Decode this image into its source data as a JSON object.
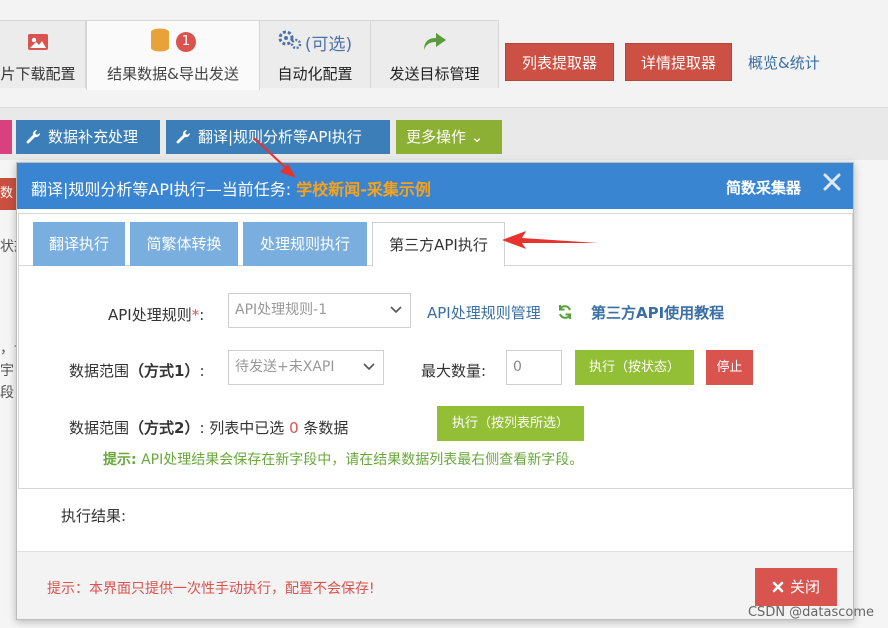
{
  "background": {
    "tabs": [
      {
        "label": "片下载配置"
      },
      {
        "label": "结果数据&导出发送",
        "badge": "1"
      },
      {
        "label": "自动化配置",
        "extra": "(可选)"
      },
      {
        "label": "发送目标管理"
      }
    ],
    "list_extractor_label": "列表提取器",
    "detail_extractor_label": "详情提取器",
    "overview_label": "概览&统计",
    "toolbar": {
      "data_fill_label": "数据补充处理",
      "api_exec_label": "翻译|规则分析等API执行",
      "more_label": "更多操作 ⌄"
    },
    "ghost_texts": [
      "数据",
      "状态",
      "，讠",
      "宇",
      "段"
    ]
  },
  "modal": {
    "title_prefix": "翻译|规则分析等API执行—当前任务: ",
    "task_name": "学校新闻-采集示例",
    "brand": "简数采集器",
    "close_icon": "close-icon",
    "tabs": [
      "翻译执行",
      "简繁体转换",
      "处理规则执行",
      "第三方API执行"
    ],
    "active_tab": "第三方API执行",
    "form": {
      "rule_label": "API处理规则",
      "required_mark": "*",
      "rule_colon": ":",
      "rule_selected": "API处理规则-1",
      "rule_manage_link": "API处理规则管理",
      "tutorial_link": "第三方API使用教程",
      "range1_label": "数据范围",
      "range1_mode": "（方式1）",
      "range1_colon": ":",
      "range1_selected": "待发送+未XAPI",
      "max_label": "最大数量:",
      "max_value": "0",
      "exec_status_label": "执行（按状态）",
      "stop_label": "停止",
      "range2_label": "数据范围",
      "range2_mode": "（方式2）",
      "range2_prefix": ": 列表中已选",
      "range2_count": "0",
      "range2_suffix": "条数据",
      "exec_list_label": "执行（按列表所选）",
      "hint_prefix": "提示:",
      "hint_text": "API处理结果会保存在新字段中，请在结果数据列表最右侧查看新字段。"
    },
    "result_label": "执行结果:",
    "footer_warning": "提示：本界面只提供一次性手动执行，配置不会保存!",
    "close_label": "关闭"
  },
  "watermark": "CSDN @datascome",
  "colors": {
    "modal_header": "#3a85d2",
    "task_name": "#f8a21c",
    "tab_inactive": "#79aede",
    "green_button": "#92bf35",
    "red_button": "#d9534f",
    "link": "#3a6ea5",
    "hint": "#6aa83b"
  }
}
